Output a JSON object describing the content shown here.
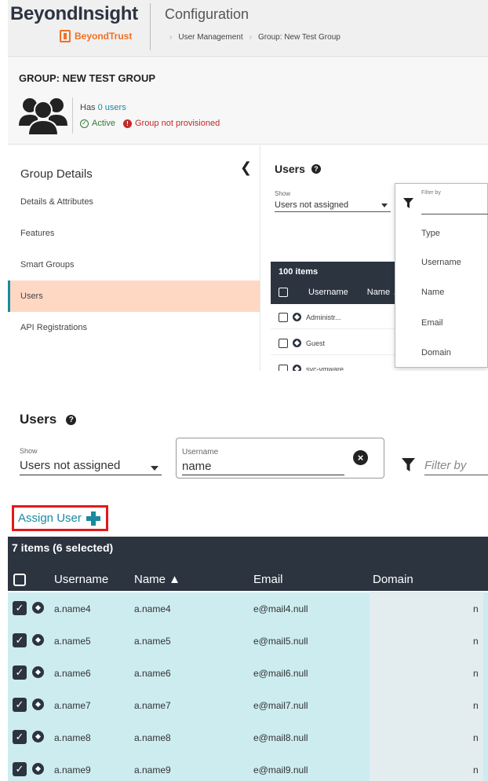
{
  "top": {
    "brand": "BeyondInsight",
    "sub_brand": "BeyondTrust",
    "page_title": "Configuration",
    "breadcrumbs": [
      "User Management",
      "Group: New Test Group"
    ],
    "group": {
      "title": "GROUP: NEW TEST GROUP",
      "users_prefix": "Has",
      "users_link": "0 users",
      "status_active": "Active",
      "status_not_provisioned": "Group not provisioned"
    },
    "nav": {
      "title": "Group Details",
      "collapse_icon": "chevron-left-icon",
      "items": [
        {
          "label": "Details & Attributes",
          "active": false
        },
        {
          "label": "Features",
          "active": false
        },
        {
          "label": "Smart Groups",
          "active": false
        },
        {
          "label": "Users",
          "active": true
        },
        {
          "label": "API Registrations",
          "active": false
        }
      ]
    },
    "users_panel": {
      "title": "Users",
      "show_label": "Show",
      "show_value": "Users not assigned",
      "count": "100 items",
      "columns": [
        "Username",
        "Name ▲"
      ],
      "rows": [
        "Administr...",
        "Guest",
        "svc-vmware"
      ]
    },
    "filter_dropdown": {
      "label": "Filter by",
      "options": [
        "Type",
        "Username",
        "Name",
        "Email",
        "Domain"
      ]
    }
  },
  "bottom": {
    "title": "Users",
    "show_label": "Show",
    "show_value": "Users not assigned",
    "username_filter": {
      "label": "Username",
      "value": "name"
    },
    "filter_placeholder": "Filter by",
    "assign_label": "Assign User",
    "count": "7 items (6 selected)",
    "columns": [
      "Username",
      "Name ▲",
      "Email",
      "Domain"
    ],
    "rows": [
      {
        "username": "a.name4",
        "name": "a.name4",
        "email": "e@mail4.null",
        "domain_suffix": "n"
      },
      {
        "username": "a.name5",
        "name": "a.name5",
        "email": "e@mail5.null",
        "domain_suffix": "n"
      },
      {
        "username": "a.name6",
        "name": "a.name6",
        "email": "e@mail6.null",
        "domain_suffix": "n"
      },
      {
        "username": "a.name7",
        "name": "a.name7",
        "email": "e@mail7.null",
        "domain_suffix": "n"
      },
      {
        "username": "a.name8",
        "name": "a.name8",
        "email": "e@mail8.null",
        "domain_suffix": "n"
      },
      {
        "username": "a.name9",
        "name": "a.name9",
        "email": "e@mail9.null",
        "domain_suffix": "n"
      }
    ]
  },
  "colors": {
    "accent": "#1a8aa0",
    "header_dark": "#2c3440",
    "nav_active": "#ffd8c4",
    "selected_row": "#ccecf0",
    "brand_orange": "#f36f21",
    "highlight_red": "#e21a1a"
  }
}
